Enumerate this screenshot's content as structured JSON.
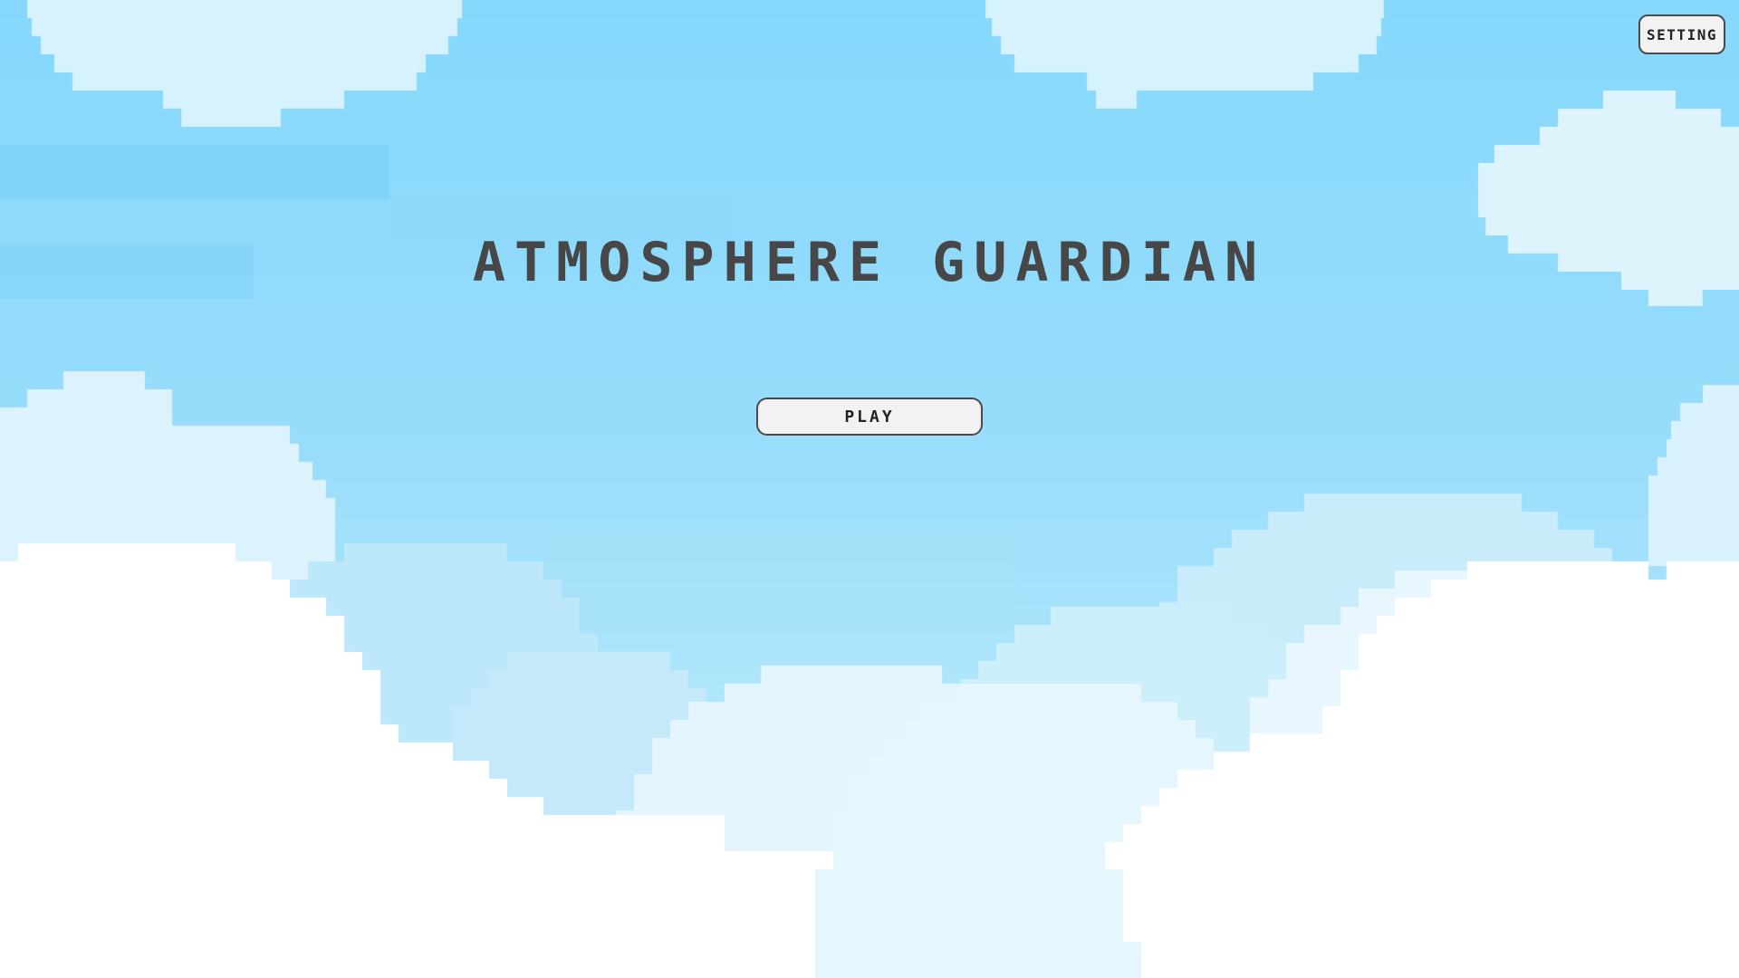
{
  "game": {
    "title": "ATMOSPHERE GUARDIAN"
  },
  "menu": {
    "play_label": "PLAY",
    "setting_label": "SETTING"
  },
  "colors": {
    "sky": "#87d9fc",
    "title_text": "#474747",
    "button_bg": "#f2f2f2",
    "button_border": "#4a4a4a",
    "cloud_white": "#ffffff"
  }
}
